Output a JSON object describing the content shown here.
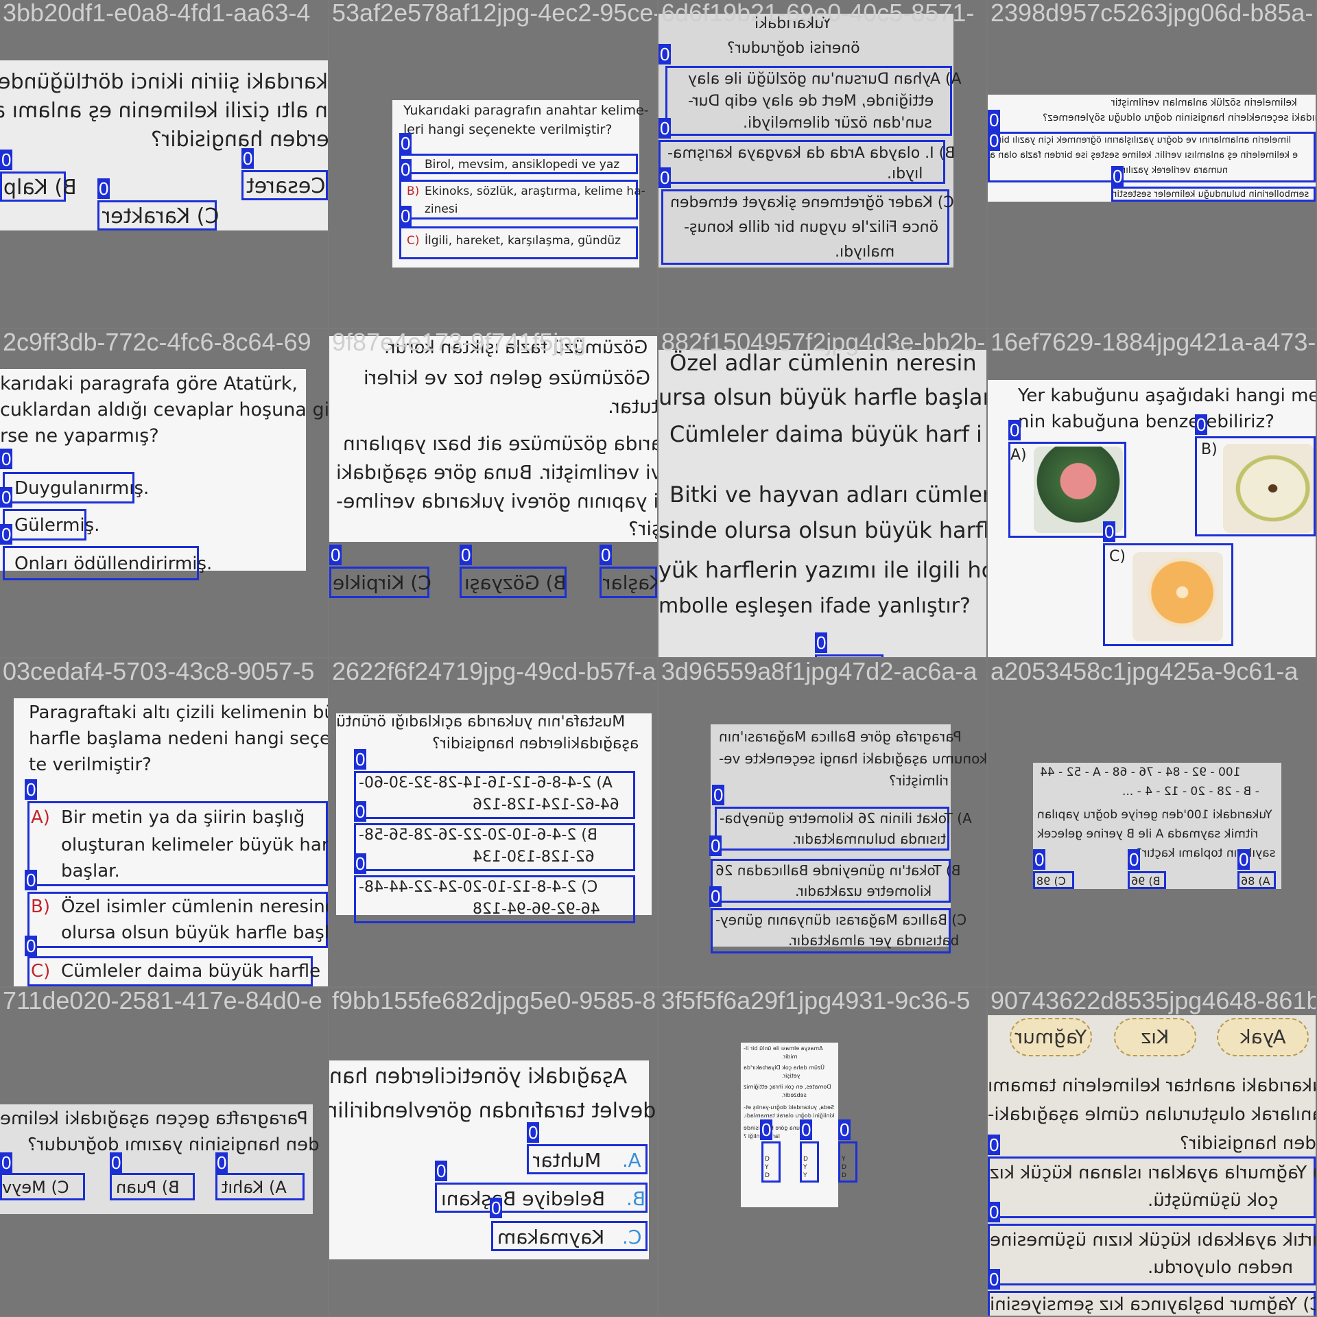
{
  "tiles": [
    {
      "title": "3bb20df1-e0a8-4fd1-aa63-4",
      "lines": [
        "karıdaki şiirin ikinci dörtlüğünde ge",
        "n altı çizili kelimenin eş anlamı aşağı",
        "kilerden hangisidir?"
      ],
      "options": [
        "B) Kalp",
        "Cesaret",
        "C) Karakter"
      ]
    },
    {
      "title": "53af2e578af12jpg-4ec2-95ce-96",
      "question": "Yukarıdaki paragrafın anahtar kelime- leri hangi seçenekte verilmiştir?",
      "q1": "Yukarıdaki paragrafın anahtar kelime-",
      "q2": "leri hangi seçenekte verilmiştir?",
      "options": [
        "Birol, mevsim, ansiklopedi ve yaz",
        "Ekinoks, sözlük, araştırma, kelime ha-",
        "zinesi",
        "İlgili, hareket, karşılaşma, gündüz"
      ],
      "letters": [
        "B)",
        "C)"
      ]
    },
    {
      "title": "6d6f19b21-69e0-40c5-8571-",
      "lines": [
        "Yukarıdaki ",
        "önerisi doğrudur?"
      ],
      "options": [
        "A) Ayhan Dursun'un gözlüğü ile alay",
        "ettiğinde, Mert de alay edip Dur-",
        "sun'dan özür dilemeliydi.",
        "B) I. olayda Arda da kavgaya karışma-",
        "lıydı.",
        "C) Kader öğretmene şikayet etmeden",
        "önce Filiz'le uygun bir dille konuş-",
        "malıydı."
      ]
    },
    {
      "title": "2398d957c5263jpg06d-b85a-",
      "lines": [
        "kelimelerin sözlük anlamları verilmiştir",
        "ağıdaki seçeneklerin hangisinin doğru olduğu söylenemez?"
      ],
      "options": [
        "limelerin anlamlarını ve doğru yazılışlarını öğrenmek için yazılı bir k",
        "e kelimelerin eş anlamlısı verilir. kelime sesteş ise birden fazla olan a",
        "numara verilerek yazılır.",
        "sembollerinin bulunduğu kelimeler sestestir"
      ]
    },
    {
      "title": "2c9ff3db-772c-4fc6-8c64-69",
      "lines": [
        "karıdaki paragrafa göre Atatürk,",
        "cuklardan aldığı cevaplar hoşuna gi-",
        "rse ne yaparmış?"
      ],
      "options": [
        "Duygulanırmış.",
        "Gülermiş.",
        "Onları ödüllendirirmiş."
      ]
    },
    {
      "title": "9f87e4e173-9f741f5jpg",
      "lines": [
        "Gözümüzü fazla ışıktan korur.",
        "Gözümüze gelen toz ve kirleri",
        "tutar.",
        "arıda gözümüze ait bazı yapıların",
        "ivi verilmiştir. Buna göre aşağıdaki",
        "gi yapının görevi yukarıda verilme-",
        "şir?"
      ],
      "options": [
        "C) Kirpikle",
        "B) Gözyaşı",
        "Kaşlar"
      ]
    },
    {
      "title": "882f1504957f2jpg4d3e-bb2b-",
      "lines": [
        "Özel adlar cümlenin neresin",
        "ursa olsun büyük harfle başlar.",
        "Cümleler daima büyük harf i",
        "Bitki ve hayvan adları cümler",
        "sinde olursa olsun büyük harfle",
        "yük harflerin yazımı ile ilgili hc",
        "mbolle eşleşen ifade yanlıştır?"
      ],
      "options": []
    },
    {
      "title": "16ef7629-1884jpg421a-a473-3",
      "lines": [
        "Yer kabuğunu aşağıdaki hangi meyve",
        "nin kabuğuna benzetebiliriz?"
      ],
      "options": [
        "A)",
        "B)",
        "C)"
      ]
    },
    {
      "title": "03cedaf4-5703-43c8-9057-5",
      "lines": [
        "Paragraftaki altı çizili kelimenin büy",
        "harfle başlama nedeni hangi seçene",
        "te verilmiştir?"
      ],
      "options": [
        "A)",
        "Bir metin ya da şiirin başlığ",
        "oluşturan kelimeler büyük harf",
        "başlar.",
        "B)",
        "Özel isimler cümlenin neresinde",
        "olursa olsun büyük harfle başlar.",
        "C)",
        "Cümleler daima büyük harfle"
      ]
    },
    {
      "title": "2622f6f24719jpg-49cd-b57f-a",
      "lines": [
        "Mustafa'nın yukarıda açıkladığı örüntü",
        "aşağıdakilerden hangisidir?"
      ],
      "options": [
        "A) 2-4-8-6-12-16-14-28-32-30-60-",
        "64-62-124-128-126",
        "B) 2-4-6-10-20-22-26-28-56-58-",
        "62-128-130-134",
        "C) 2-4-8-12-10-20-24-22-44-48-",
        "46-92-96-94-128"
      ]
    },
    {
      "title": "3d96559a8f1jpg47d2-ac6a-a",
      "lines": [
        "Paragrafa göre Ballıca Mağarası'nın",
        "konumu aşağıdaki hangi seçenekte ve-",
        "rilmiştir?"
      ],
      "options": [
        "A) Tokat ilinin 26 kilometre güneybа-",
        "tısında bulunmaktadır.",
        "B) Tokat'ın güneyinde Ballıcadan 26",
        "kilometre uzaktadır.",
        "C) Ballıca Mağarası dünyanın güney-",
        "batısında yer almaktadır."
      ]
    },
    {
      "title": "a2053458c1jpg425a-9c61-a",
      "lines": [
        "100 - 92 - 84 - 76 - 68 - A - 52 - 44",
        "- B - 28 - 20 - 12 - 4 - ...",
        "Yukarıdaki 100'den geriye doğru yapılan",
        "ritmik saymada A ile B yerine gelecek",
        "sayıların toplamı kaçtır?"
      ],
      "options": [
        "C) 98",
        "B) 96",
        "A) 86"
      ]
    },
    {
      "title": "711de020-2581-417e-84d0-e",
      "lines": [
        "Paragrafta geçen aşağıdaki kelime",
        "den hangisinin yazımı doğrudur?"
      ],
      "options": [
        "C) Meyv",
        "B) Puan",
        "A) Kahıt"
      ]
    },
    {
      "title": "f9bb155fe682djpg5e0-9585-8",
      "lines": [
        "Aşağıdaki yöneticilerden han",
        "devlet tarafından görevlendirilir"
      ],
      "options": [
        "A.",
        "Muhtar",
        "B.",
        "Belediye Başkanı",
        "C.",
        "Kaymakam"
      ]
    },
    {
      "title": "3f5f5f6a29f1jpg4931-9c36-5",
      "lines": [
        "Amasya elması ile ünlü bir il-",
        "midir.",
        "Üzüm daha çok Diyarbakır'da",
        "yetişir.",
        "Domates, en çok ihraç ettiğimiz",
        "sebzedir.",
        "Seda, yukarıdaki doğru-yanlış et-",
        "kinliğini doğru olarak tamamladı.",
        "Buna göre hangisinde ",
        "larak kinliği ?"
      ],
      "options": [
        "D",
        "Y",
        "D",
        "D",
        "Y",
        "Y",
        "Y",
        "D",
        "D"
      ]
    },
    {
      "title": "90743622d8535jpg4648-861b-",
      "lines": [
        "Yağmur",
        "Kız",
        "Ayak",
        "ukarıdaki anahtar kelimelerin tamamı",
        "ullanılarak oluşturulan cümle aşağıdaki-",
        "erden hangisidir?"
      ],
      "options": [
        "A) Yağmurla ayakları ıslanan küçük kız",
        "çok üşümüştü.",
        "B) Yırtık ayakkabı küçük kızın üşümesine",
        "neden oluyordu.",
        "C) Yağmur başlayınca kız şemsiyesini"
      ]
    }
  ],
  "tag": "0",
  "colors": {
    "box": "#1c2fd6",
    "paper": "#ececec",
    "background": "#767676"
  }
}
